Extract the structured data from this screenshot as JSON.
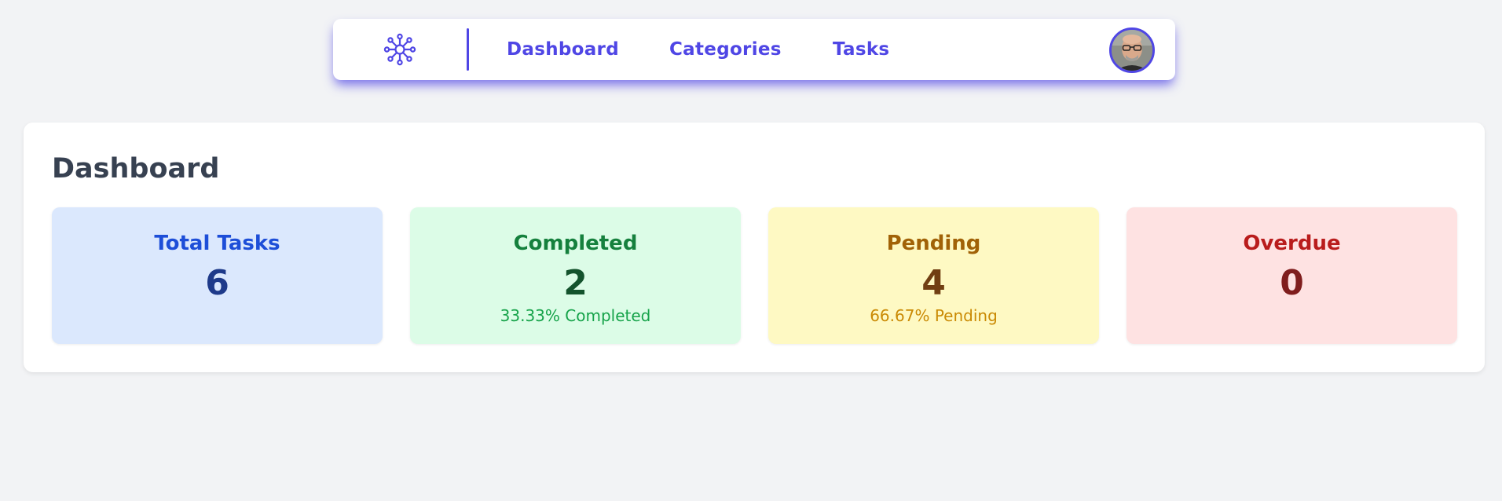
{
  "nav": {
    "logo_icon": "network-hub-icon",
    "links": [
      {
        "label": "Dashboard"
      },
      {
        "label": "Categories"
      },
      {
        "label": "Tasks"
      }
    ],
    "accent_color": "#4f46e5",
    "avatar_icon": "user-avatar"
  },
  "main": {
    "title": "Dashboard",
    "stats": [
      {
        "label": "Total Tasks",
        "value": "6",
        "sub": "",
        "bg": "#dbe8fd",
        "label_color": "#1d4ed8",
        "value_color": "#1e3a8a",
        "sub_color": "#1d4ed8"
      },
      {
        "label": "Completed",
        "value": "2",
        "sub": "33.33% Completed",
        "bg": "#dcfce7",
        "label_color": "#15803d",
        "value_color": "#14532d",
        "sub_color": "#16a34a"
      },
      {
        "label": "Pending",
        "value": "4",
        "sub": "66.67% Pending",
        "bg": "#fef9c3",
        "label_color": "#a16207",
        "value_color": "#713f12",
        "sub_color": "#ca8a04"
      },
      {
        "label": "Overdue",
        "value": "0",
        "sub": "",
        "bg": "#fee2e2",
        "label_color": "#b91c1c",
        "value_color": "#7f1d1d",
        "sub_color": "#dc2626"
      }
    ]
  }
}
